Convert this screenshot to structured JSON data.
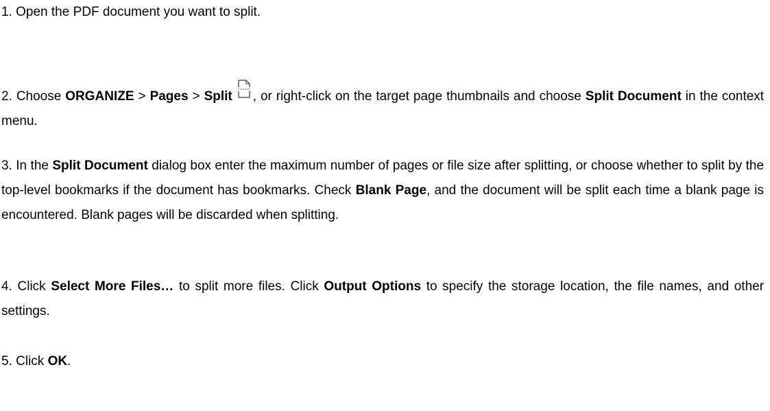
{
  "steps": [
    {
      "number": "1.",
      "text": "Open the PDF document you want to split."
    },
    {
      "number": "2.",
      "choose_prefix": "Choose",
      "organize": "ORGANIZE",
      "sep1": ">",
      "pages": "Pages",
      "sep2": ">",
      "split": "Split",
      "icon": "split-page-icon",
      "text_after_icon": ", or right-click on the target page thumbnails and choose",
      "split_document": "Split Document",
      "text_end": "in the context menu."
    },
    {
      "number": "3.",
      "text_a": "In the",
      "split_document": "Split Document",
      "text_b": "dialog box enter the maximum number of pages or file size after splitting, or choose whether to split by the top-level bookmarks if the document has bookmarks. Check",
      "blank_page": "Blank Page",
      "text_c": ", and the document will be split each time a blank page is encountered. Blank pages will be discarded when splitting."
    },
    {
      "number": "4.",
      "click_a": "Click",
      "select_more_files": "Select More Files…",
      "text_a": "to split more files. Click",
      "output_options": "Output Options",
      "text_b": "to specify the storage location, the file names, and other settings."
    },
    {
      "number": "5.",
      "click": "Click",
      "ok": "OK",
      "period": "."
    }
  ],
  "colors": {
    "text": "#000000",
    "background": "#ffffff",
    "icon_stroke": "#5a5a5a",
    "icon_dash": "#3a7bd5"
  }
}
